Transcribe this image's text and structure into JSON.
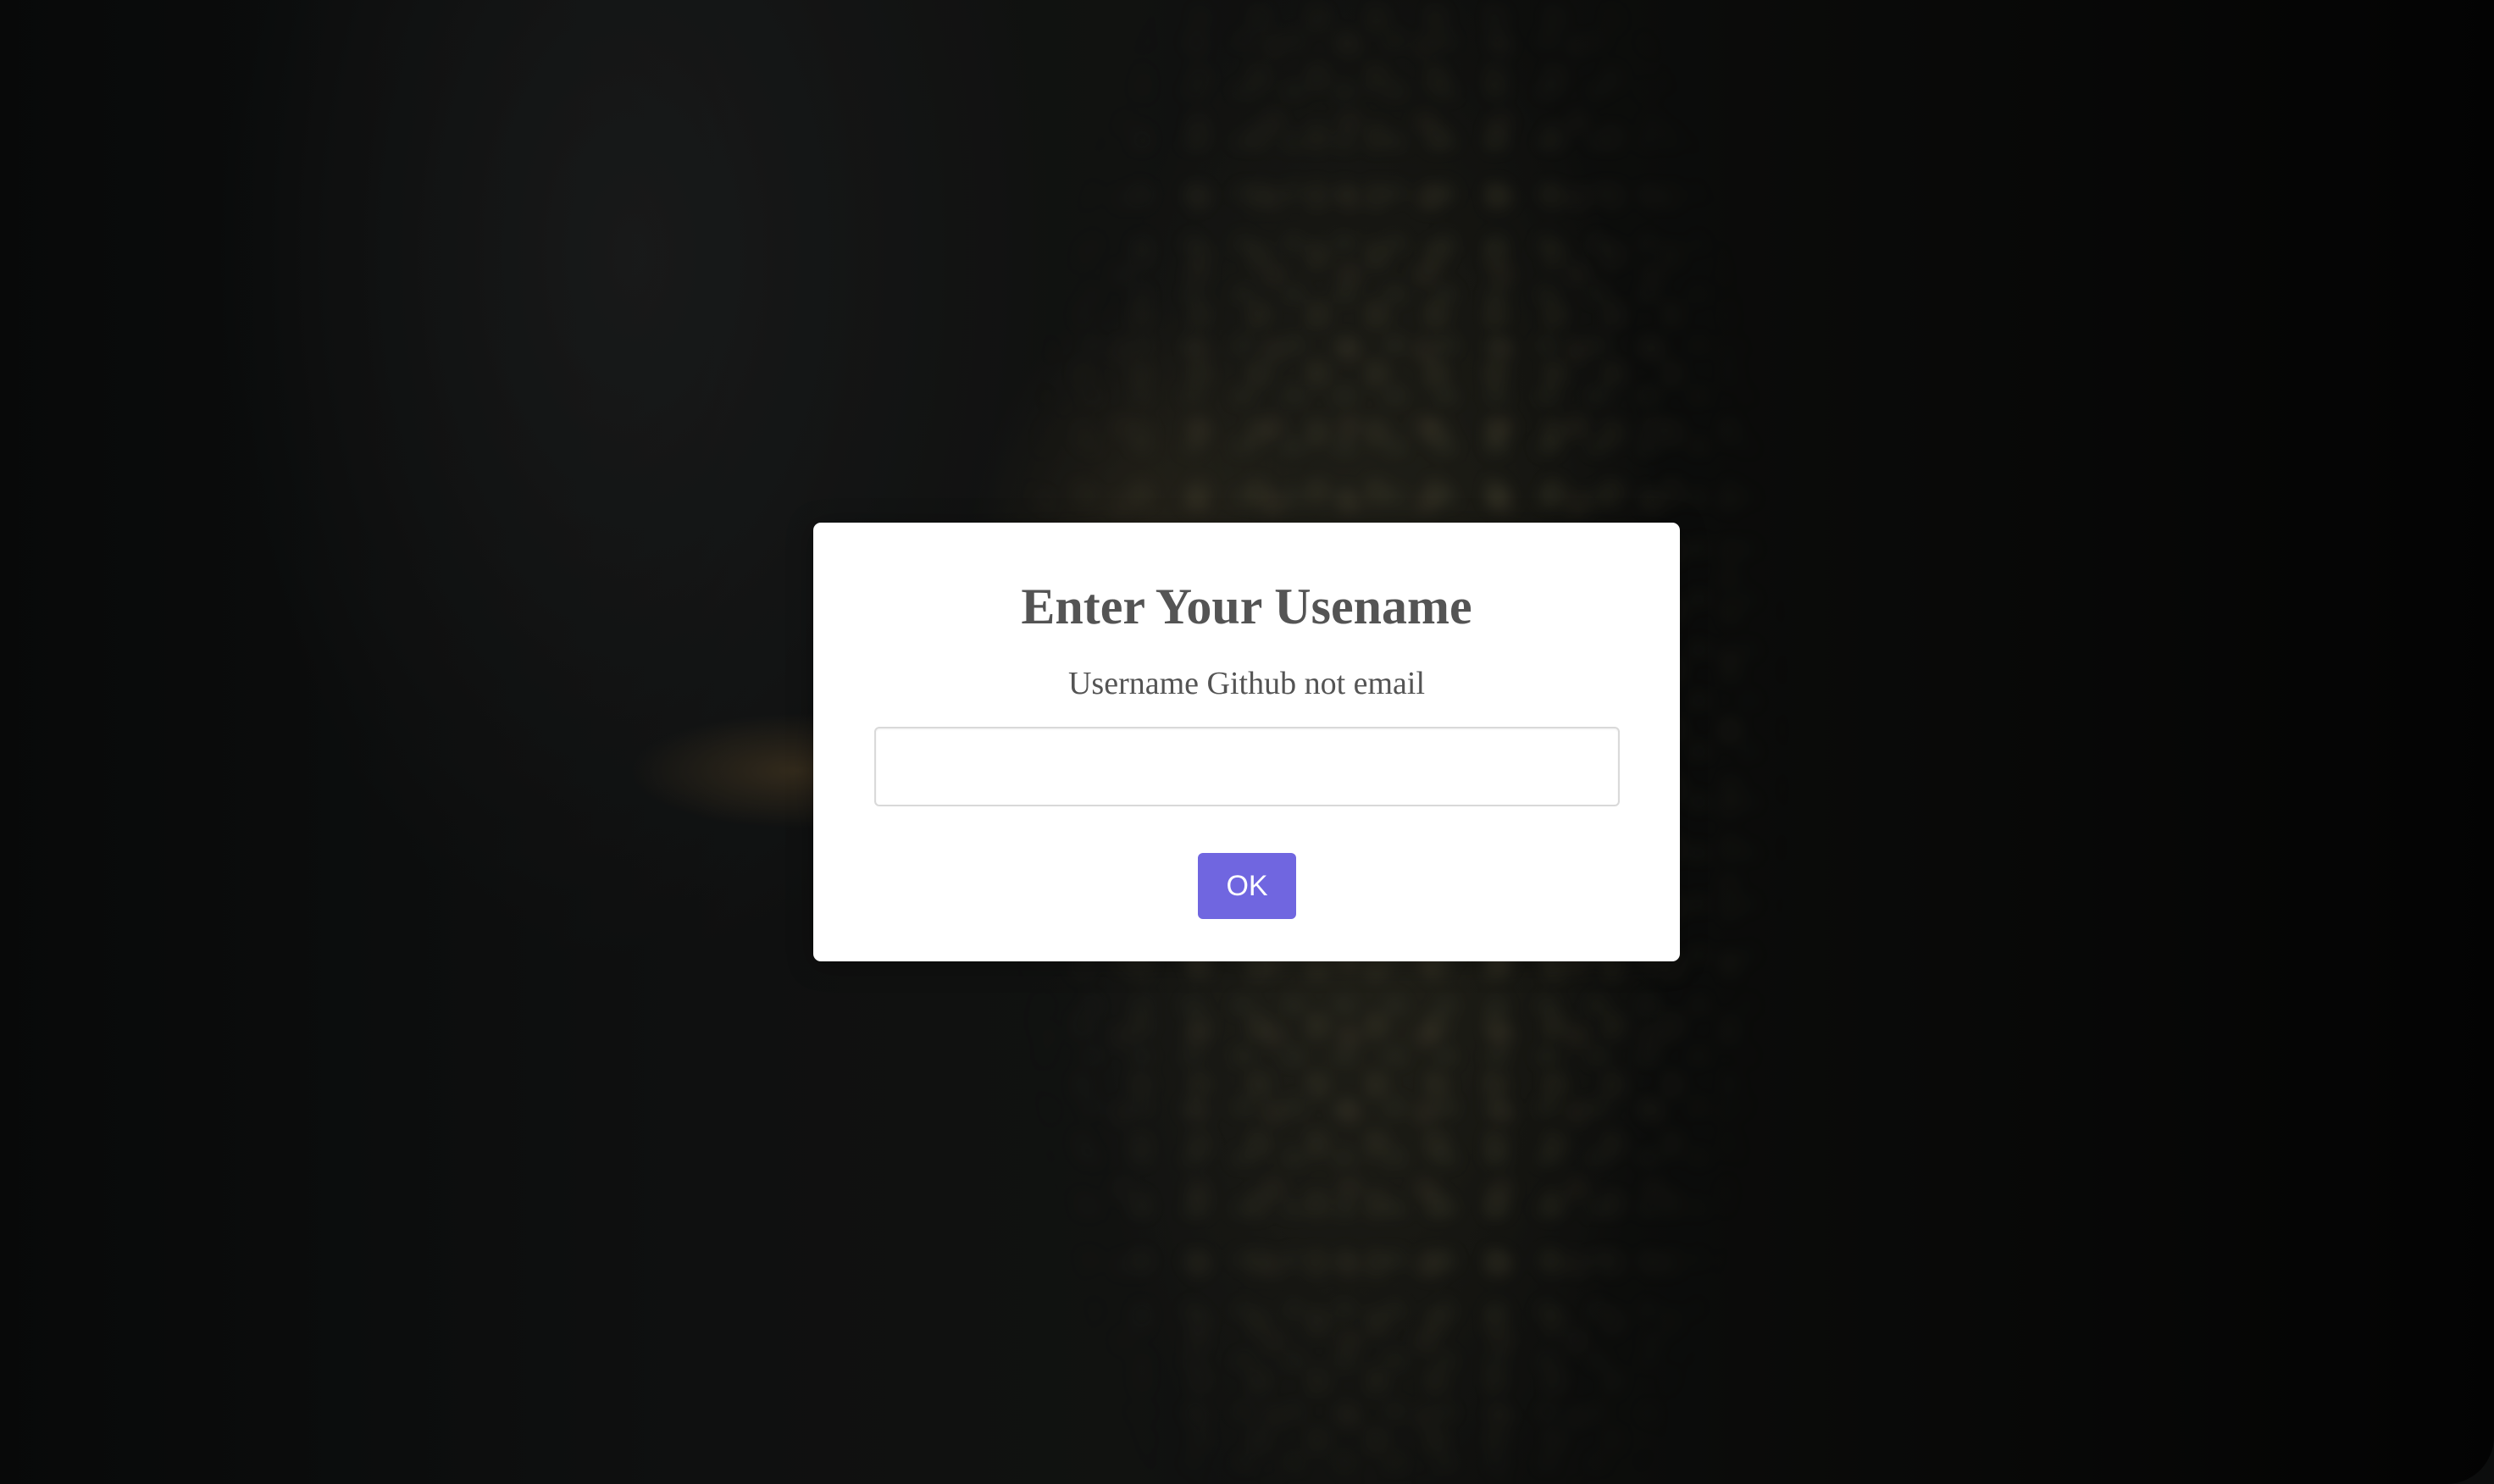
{
  "dialog": {
    "title": "Enter Your Usename",
    "subtitle": "Username Github not email",
    "input_value": "",
    "input_placeholder": "",
    "ok_label": "OK"
  },
  "colors": {
    "confirm_button": "#7066e0",
    "text": "#545454",
    "dialog_background": "#ffffff"
  }
}
